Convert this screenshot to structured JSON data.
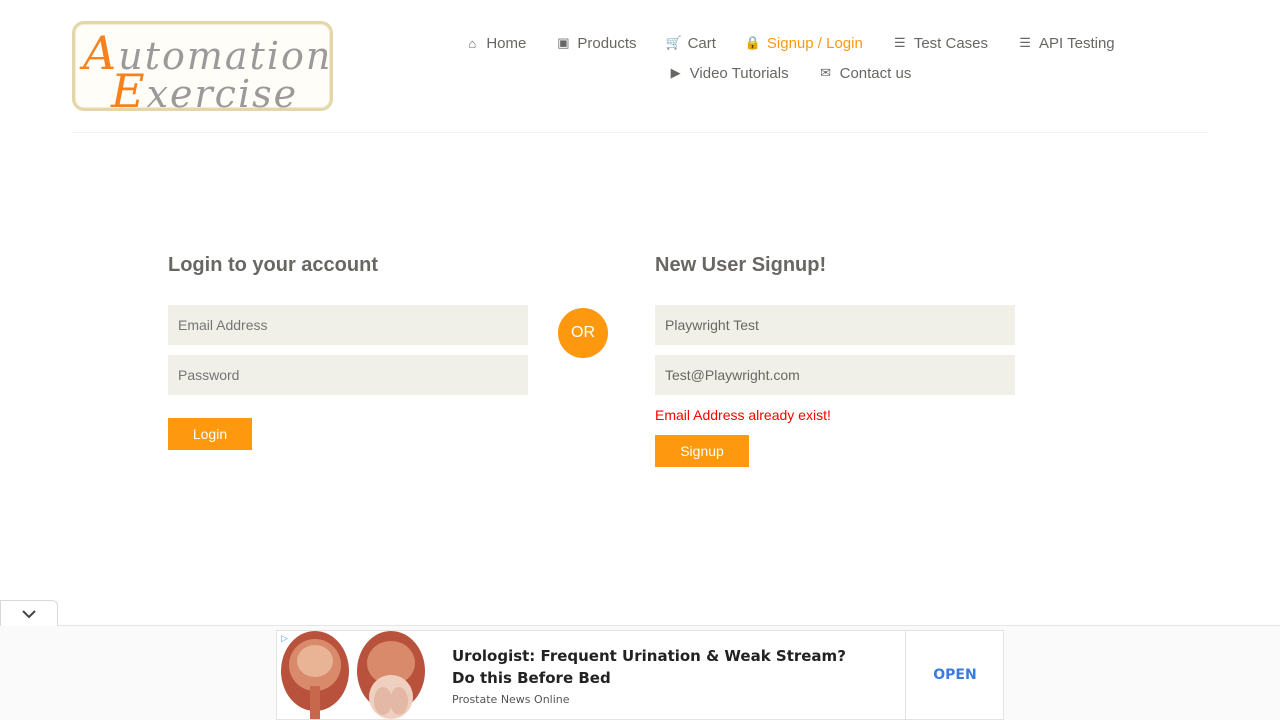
{
  "logo": {
    "line1_cap": "A",
    "line1_rest": "utomation",
    "line2_cap": "E",
    "line2_rest": "xercise"
  },
  "nav": {
    "row1": [
      {
        "label": "Home",
        "icon": "home-icon",
        "glyph": "⌂",
        "active": false
      },
      {
        "label": "Products",
        "icon": "briefcase-icon",
        "glyph": "▣",
        "active": false
      },
      {
        "label": "Cart",
        "icon": "cart-icon",
        "glyph": "🛒",
        "active": false
      },
      {
        "label": "Signup / Login",
        "icon": "lock-icon",
        "glyph": "🔒",
        "active": true
      },
      {
        "label": "Test Cases",
        "icon": "list-icon",
        "glyph": "☰",
        "active": false
      },
      {
        "label": "API Testing",
        "icon": "list-icon",
        "glyph": "☰",
        "active": false
      }
    ],
    "row2": [
      {
        "label": "Video Tutorials",
        "icon": "youtube-icon",
        "glyph": "▶",
        "active": false
      },
      {
        "label": "Contact us",
        "icon": "envelope-icon",
        "glyph": "✉",
        "active": false
      }
    ]
  },
  "login": {
    "title": "Login to your account",
    "email_placeholder": "Email Address",
    "password_placeholder": "Password",
    "button": "Login"
  },
  "or_label": "OR",
  "signup": {
    "title": "New User Signup!",
    "name_value": "Playwright Test",
    "email_value": "Test@Playwright.com",
    "error": "Email Address already exist!",
    "button": "Signup"
  },
  "ad": {
    "title": "Urologist: Frequent Urination & Weak Stream? Do this Before Bed",
    "source": "Prostate News Online",
    "cta": "OPEN"
  },
  "colors": {
    "accent": "#fe980f",
    "field_bg": "#f0f0e9",
    "text": "#696763",
    "error": "#ff0000"
  }
}
